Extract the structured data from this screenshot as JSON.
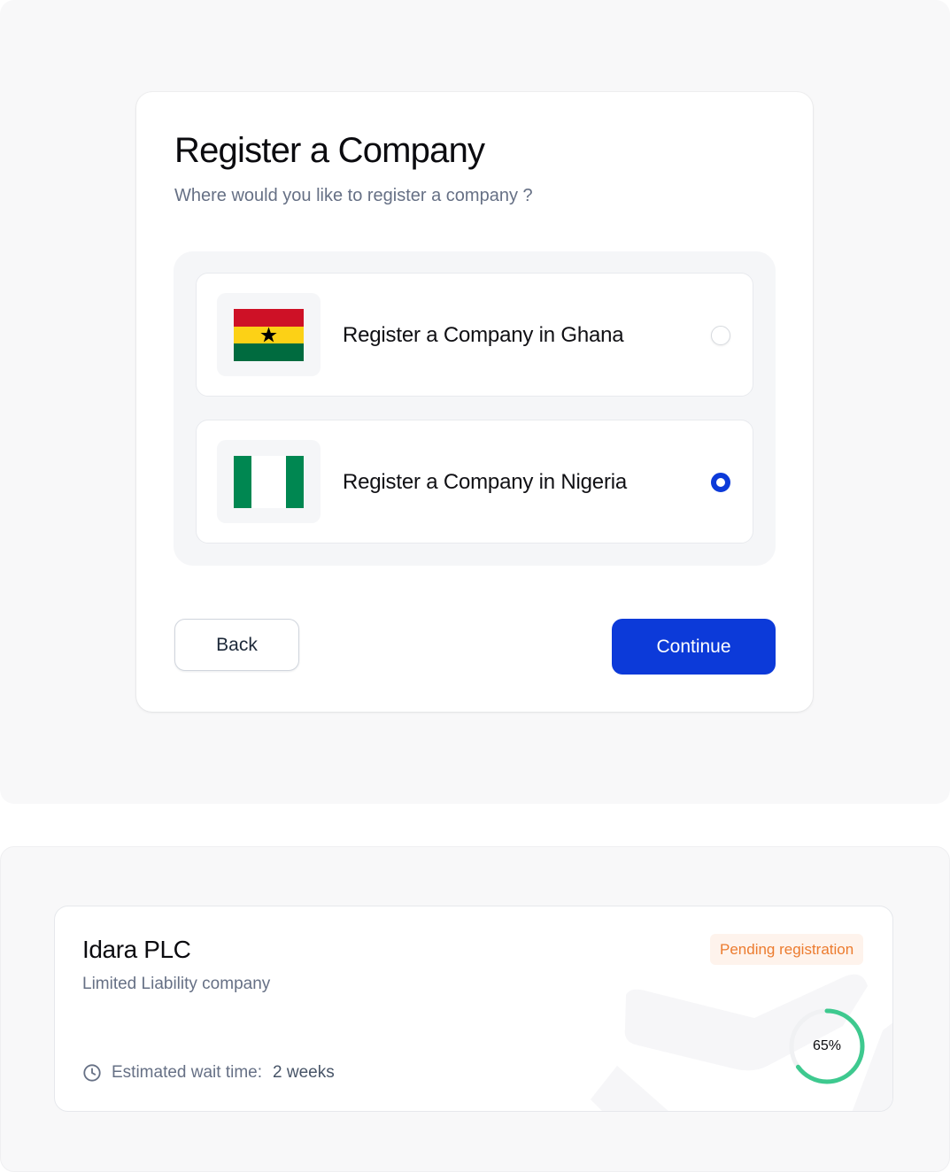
{
  "register": {
    "title": "Register a Company",
    "subtitle": "Where would you like to register a company ?",
    "options": [
      {
        "label": "Register a Company in Ghana",
        "flag_icon": "ghana-flag-icon",
        "selected": false
      },
      {
        "label": "Register a Company in Nigeria",
        "flag_icon": "nigeria-flag-icon",
        "selected": true
      }
    ],
    "back_label": "Back",
    "continue_label": "Continue"
  },
  "company": {
    "name": "Idara PLC",
    "type": "Limited Liability company",
    "status": "Pending registration",
    "wait_label": "Estimated wait time:",
    "wait_value": "2 weeks",
    "progress_percent": 65,
    "progress_label": "65%"
  },
  "colors": {
    "primary": "#0c3ad9",
    "status_text": "#ec7b2e",
    "status_bg": "#fef3ec",
    "progress": "#3ec98f"
  }
}
